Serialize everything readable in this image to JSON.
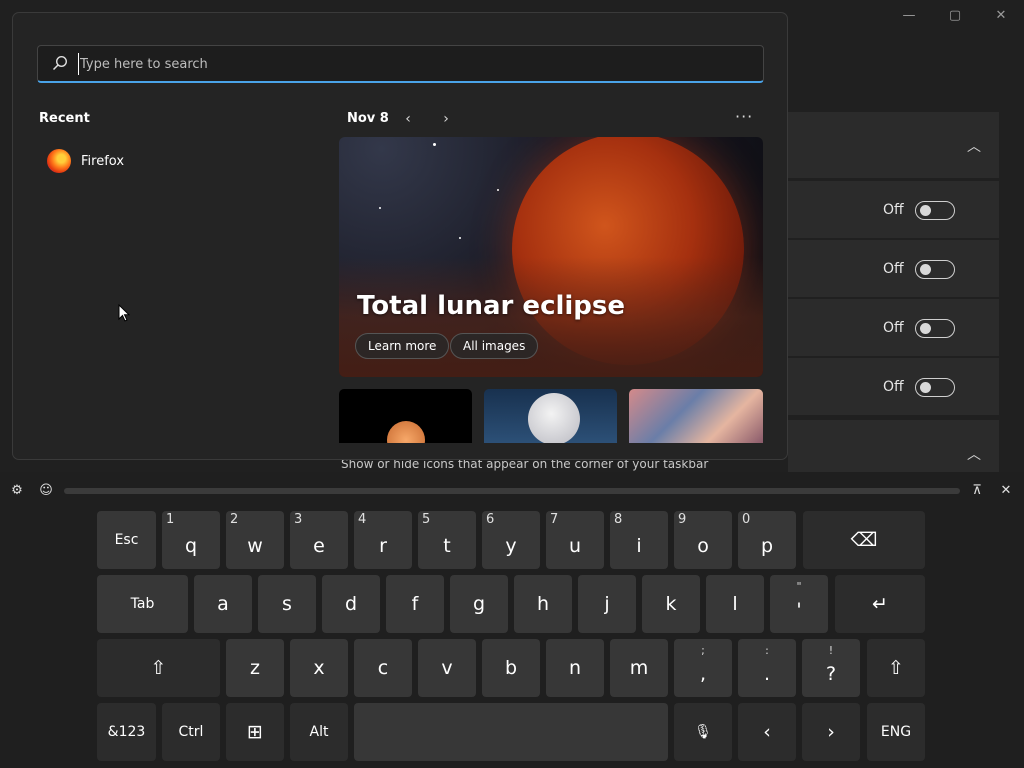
{
  "settings": {
    "window_controls": {
      "minimize": "—",
      "maximize": "▢",
      "close": "✕"
    },
    "toggle_rows": [
      {
        "state": "Off"
      },
      {
        "state": "Off"
      },
      {
        "state": "Off"
      },
      {
        "state": "Off"
      }
    ],
    "overflow_text": "",
    "section_subtitle": "Show or hide icons that appear on the corner of your taskbar"
  },
  "start_menu": {
    "search": {
      "placeholder": "Type here to search"
    },
    "recent": {
      "title": "Recent",
      "items": [
        {
          "label": "Firefox",
          "icon": "firefox-icon"
        }
      ]
    },
    "spotlight": {
      "date": "Nov 8",
      "prev_icon": "‹",
      "next_icon": "›",
      "more_icon": "···",
      "hero_title": "Total lunar eclipse",
      "learn_more": "Learn more",
      "all_images": "All images"
    }
  },
  "keyboard": {
    "row1": [
      {
        "label": "Esc"
      },
      {
        "label": "q",
        "num": "1"
      },
      {
        "label": "w",
        "num": "2"
      },
      {
        "label": "e",
        "num": "3"
      },
      {
        "label": "r",
        "num": "4"
      },
      {
        "label": "t",
        "num": "5"
      },
      {
        "label": "y",
        "num": "6"
      },
      {
        "label": "u",
        "num": "7"
      },
      {
        "label": "i",
        "num": "8"
      },
      {
        "label": "o",
        "num": "9"
      },
      {
        "label": "p",
        "num": "0"
      },
      {
        "label": "⌫"
      }
    ],
    "row2": [
      {
        "label": "Tab"
      },
      {
        "label": "a"
      },
      {
        "label": "s"
      },
      {
        "label": "d"
      },
      {
        "label": "f"
      },
      {
        "label": "g"
      },
      {
        "label": "h"
      },
      {
        "label": "j"
      },
      {
        "label": "k"
      },
      {
        "label": "l"
      },
      {
        "label": "'",
        "top": "\""
      },
      {
        "label": "↵"
      }
    ],
    "row3": [
      {
        "label": "⇧"
      },
      {
        "label": "z"
      },
      {
        "label": "x"
      },
      {
        "label": "c"
      },
      {
        "label": "v"
      },
      {
        "label": "b"
      },
      {
        "label": "n"
      },
      {
        "label": "m"
      },
      {
        "label": ",",
        "top": ";"
      },
      {
        "label": ".",
        "top": ":"
      },
      {
        "label": "?",
        "top": "!"
      },
      {
        "label": "⇧"
      }
    ],
    "row4": [
      {
        "label": "&123"
      },
      {
        "label": "Ctrl"
      },
      {
        "label": "⊞"
      },
      {
        "label": "Alt"
      },
      {
        "label": ""
      },
      {
        "label": "🎙"
      },
      {
        "label": "‹"
      },
      {
        "label": "›"
      },
      {
        "label": "ENG"
      }
    ],
    "toolbar": {
      "settings": "⚙",
      "sticker": "☺",
      "dock": "⊼",
      "close": "✕"
    }
  }
}
